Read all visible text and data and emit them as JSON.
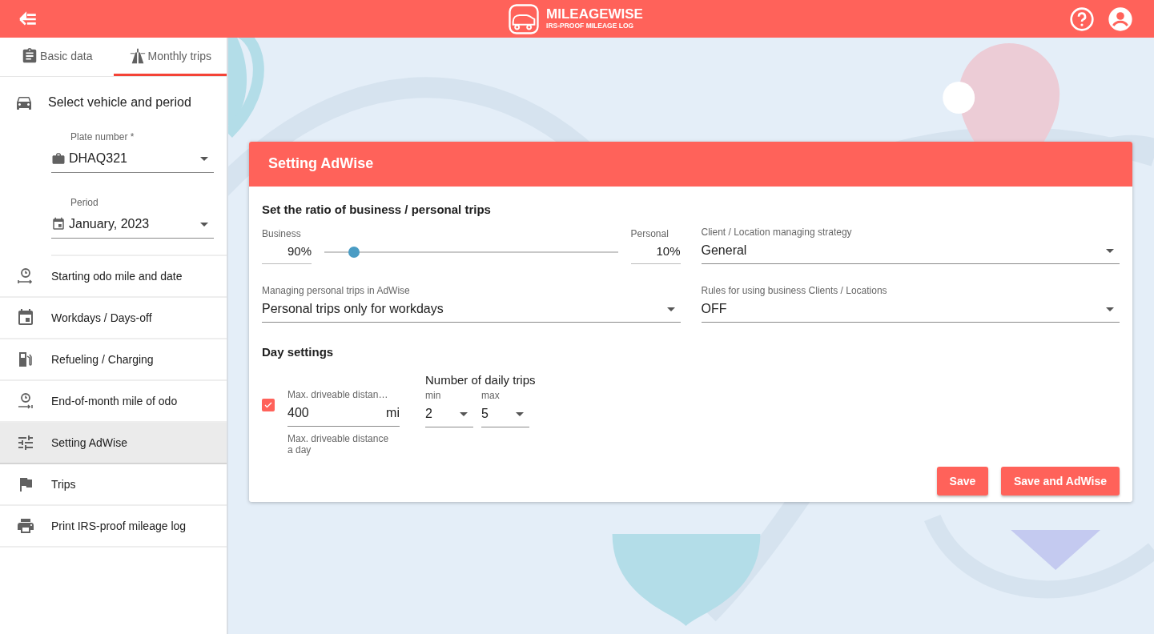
{
  "header": {
    "brand": "MILEAGEWISE",
    "tagline": "IRS-PROOF MILEAGE LOG"
  },
  "tabs": [
    {
      "label": "Basic data",
      "selected": false
    },
    {
      "label": "Monthly trips",
      "selected": true
    }
  ],
  "vehicle_section": {
    "title": "Select vehicle and period",
    "fields": [
      {
        "label": "Plate number *",
        "value": "DHAQ321"
      },
      {
        "label": "Period",
        "value": "January, 2023"
      }
    ]
  },
  "menu": [
    {
      "label": "Starting odo mile and date",
      "selected": false
    },
    {
      "label": "Workdays / Days-off",
      "selected": false
    },
    {
      "label": "Refueling / Charging",
      "selected": false
    },
    {
      "label": "End-of-month mile of odo",
      "selected": false
    },
    {
      "label": "Setting AdWise",
      "selected": true
    },
    {
      "label": "Trips",
      "selected": false
    },
    {
      "label": "Print IRS-proof mileage log",
      "selected": false
    }
  ],
  "card": {
    "title": "Setting AdWise",
    "ratio_heading": "Set the ratio of business / personal trips",
    "business": {
      "label": "Business",
      "value": "90%"
    },
    "personal": {
      "label": "Personal",
      "value": "10%"
    },
    "slider": {
      "level": 0.1
    },
    "strategy": {
      "label": "Client / Location managing strategy",
      "value": "General"
    },
    "personal_trips": {
      "label": "Managing personal trips in AdWise",
      "value": "Personal trips only for workdays"
    },
    "rules": {
      "label": "Rules for using business Clients / Locations",
      "value": "OFF"
    },
    "day_heading": "Day settings",
    "distance": {
      "checked": true,
      "label": "Max. driveable distan…",
      "value": "400",
      "unit": "mi",
      "helper": "Max. driveable distance a day"
    },
    "trips": {
      "heading": "Number of daily trips",
      "min": {
        "label": "min",
        "value": "2"
      },
      "max": {
        "label": "max",
        "value": "5"
      }
    },
    "buttons": [
      "Save",
      "Save and AdWise"
    ]
  }
}
